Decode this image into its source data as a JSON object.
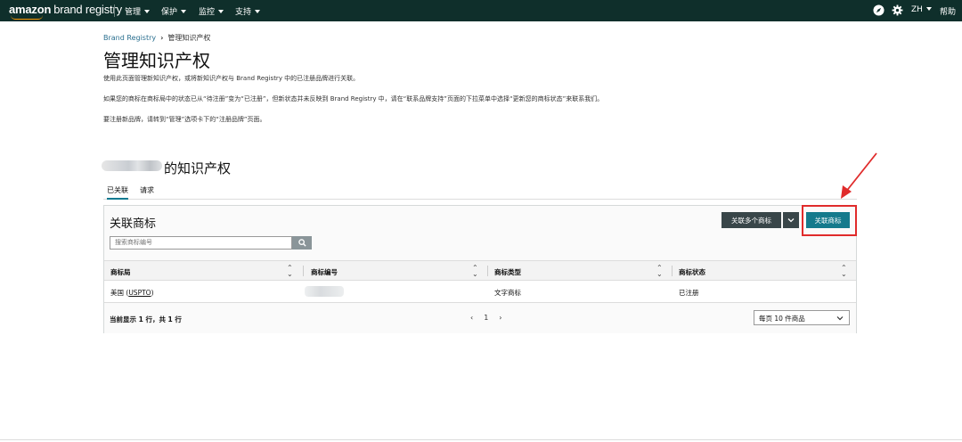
{
  "nav": {
    "brand_a": "amazon",
    "brand_b": "brand registry",
    "menus": [
      "管理",
      "保护",
      "监控",
      "支持"
    ],
    "lang": "ZH",
    "help": "帮助",
    "icons": [
      "compass-icon",
      "gear-icon"
    ],
    "colors": {
      "bar": "#0f2f2b",
      "smile": "#ff9900"
    }
  },
  "breadcrumb": {
    "root": "Brand Registry",
    "sep": "›",
    "current": "管理知识产权"
  },
  "page": {
    "title": "管理知识产权",
    "desc1": "使用此页面管理新知识产权，或将新知识产权与 Brand Registry 中的已注册品牌进行关联。",
    "desc2": "如果您的商标在商标局中的状态已从“待注册”变为“已注册”，但新状态并未反映到 Brand Registry 中，请在“联系品牌支持”页面的下拉菜单中选择“更新您的商标状态”来联系我们。",
    "desc3": "要注册新品牌，请转到“管理”选项卡下的“注册品牌”页面。",
    "section_title": "的知识产权"
  },
  "tabs": [
    "已关联",
    "请求"
  ],
  "panel": {
    "title": "关联商标",
    "search_placeholder": "搜索商标编号",
    "btn_multi": "关联多个商标",
    "btn_link": "关联商标",
    "columns": [
      "商标局",
      "商标编号",
      "商标类型",
      "商标状态"
    ],
    "rows": [
      {
        "office": "美国 (USPTO)",
        "office_prefix": "美国 (",
        "office_link": "USPTO",
        "office_suffix": ")",
        "number": "",
        "type": "文字商标",
        "status": "已注册"
      }
    ],
    "count_text": "当前显示 1 行，共 1 行",
    "page_current": "1",
    "per_page": "每页 10 件商品"
  },
  "annotation": {
    "color": "#e02b2b"
  }
}
